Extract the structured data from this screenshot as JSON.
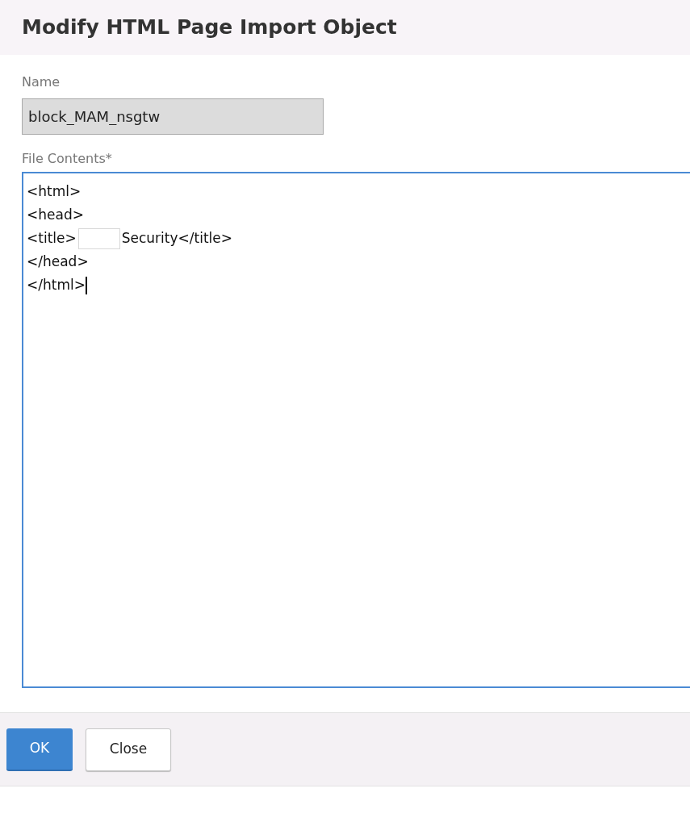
{
  "dialog": {
    "title": "Modify HTML Page Import Object"
  },
  "name_field": {
    "label": "Name",
    "value": "block_MAM_nsgtw",
    "disabled": true
  },
  "contents_field": {
    "label": "File Contents*",
    "focused": true,
    "lines": [
      {
        "segments": [
          "<html>"
        ]
      },
      {
        "segments": [
          "<head>"
        ]
      },
      {
        "segments": [
          "<title>",
          "Security</title>"
        ],
        "redacted": true
      },
      {
        "segments": [
          "</head>"
        ]
      },
      {
        "segments": [
          "</html>"
        ],
        "caret": true
      }
    ]
  },
  "buttons": [
    {
      "label": "OK",
      "kind": "primary"
    },
    {
      "label": "Close",
      "kind": "secondary"
    }
  ]
}
